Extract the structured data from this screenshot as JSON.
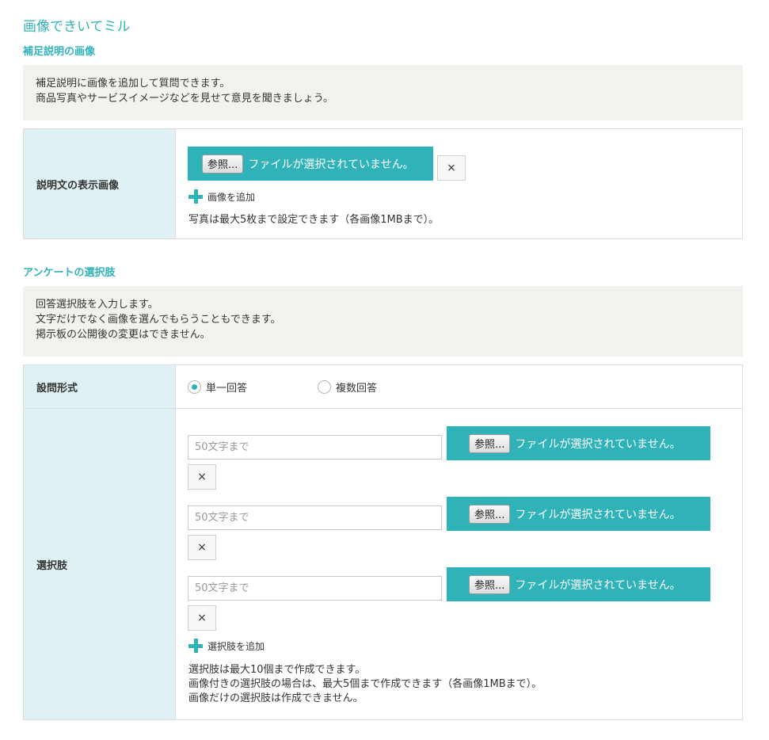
{
  "page": {
    "title": "画像できいてミル"
  },
  "supplement": {
    "heading": "補足説明の画像",
    "info": [
      "補足説明に画像を追加して質問できます。",
      "商品写真やサービスイメージなどを見せて意見を聞きましょう。"
    ],
    "row_label": "説明文の表示画像",
    "browse_label": "参照...",
    "file_status": "ファイルが選択されていません。",
    "clear_label": "×",
    "add_label": "画像を追加",
    "note": "写真は最大5枚まで設定できます（各画像1MBまで）。"
  },
  "choices": {
    "heading": "アンケートの選択肢",
    "info": [
      "回答選択肢を入力します。",
      "文字だけでなく画像を選んでもらうこともできます。",
      "掲示板の公開後の変更はできません。"
    ],
    "format_label": "設問形式",
    "format_options": [
      {
        "label": "単一回答",
        "checked": true
      },
      {
        "label": "複数回答",
        "checked": false
      }
    ],
    "options_label": "選択肢",
    "items": [
      {
        "placeholder": "50文字まで",
        "browse_label": "参照...",
        "file_status": "ファイルが選択されていません。",
        "clear_label": "×"
      },
      {
        "placeholder": "50文字まで",
        "browse_label": "参照...",
        "file_status": "ファイルが選択されていません。",
        "clear_label": "×"
      },
      {
        "placeholder": "50文字まで",
        "browse_label": "参照...",
        "file_status": "ファイルが選択されていません。",
        "clear_label": "×"
      }
    ],
    "add_label": "選択肢を追加",
    "notes": [
      "選択肢は最大10個まで作成できます。",
      "画像付きの選択肢の場合は、最大5個まで作成できます（各画像1MBまで）。",
      "画像だけの選択肢は作成できません。"
    ]
  },
  "colors": {
    "accent": "#30b3b8",
    "label_bg": "#dff1f4",
    "info_bg": "#f2f2ee"
  }
}
